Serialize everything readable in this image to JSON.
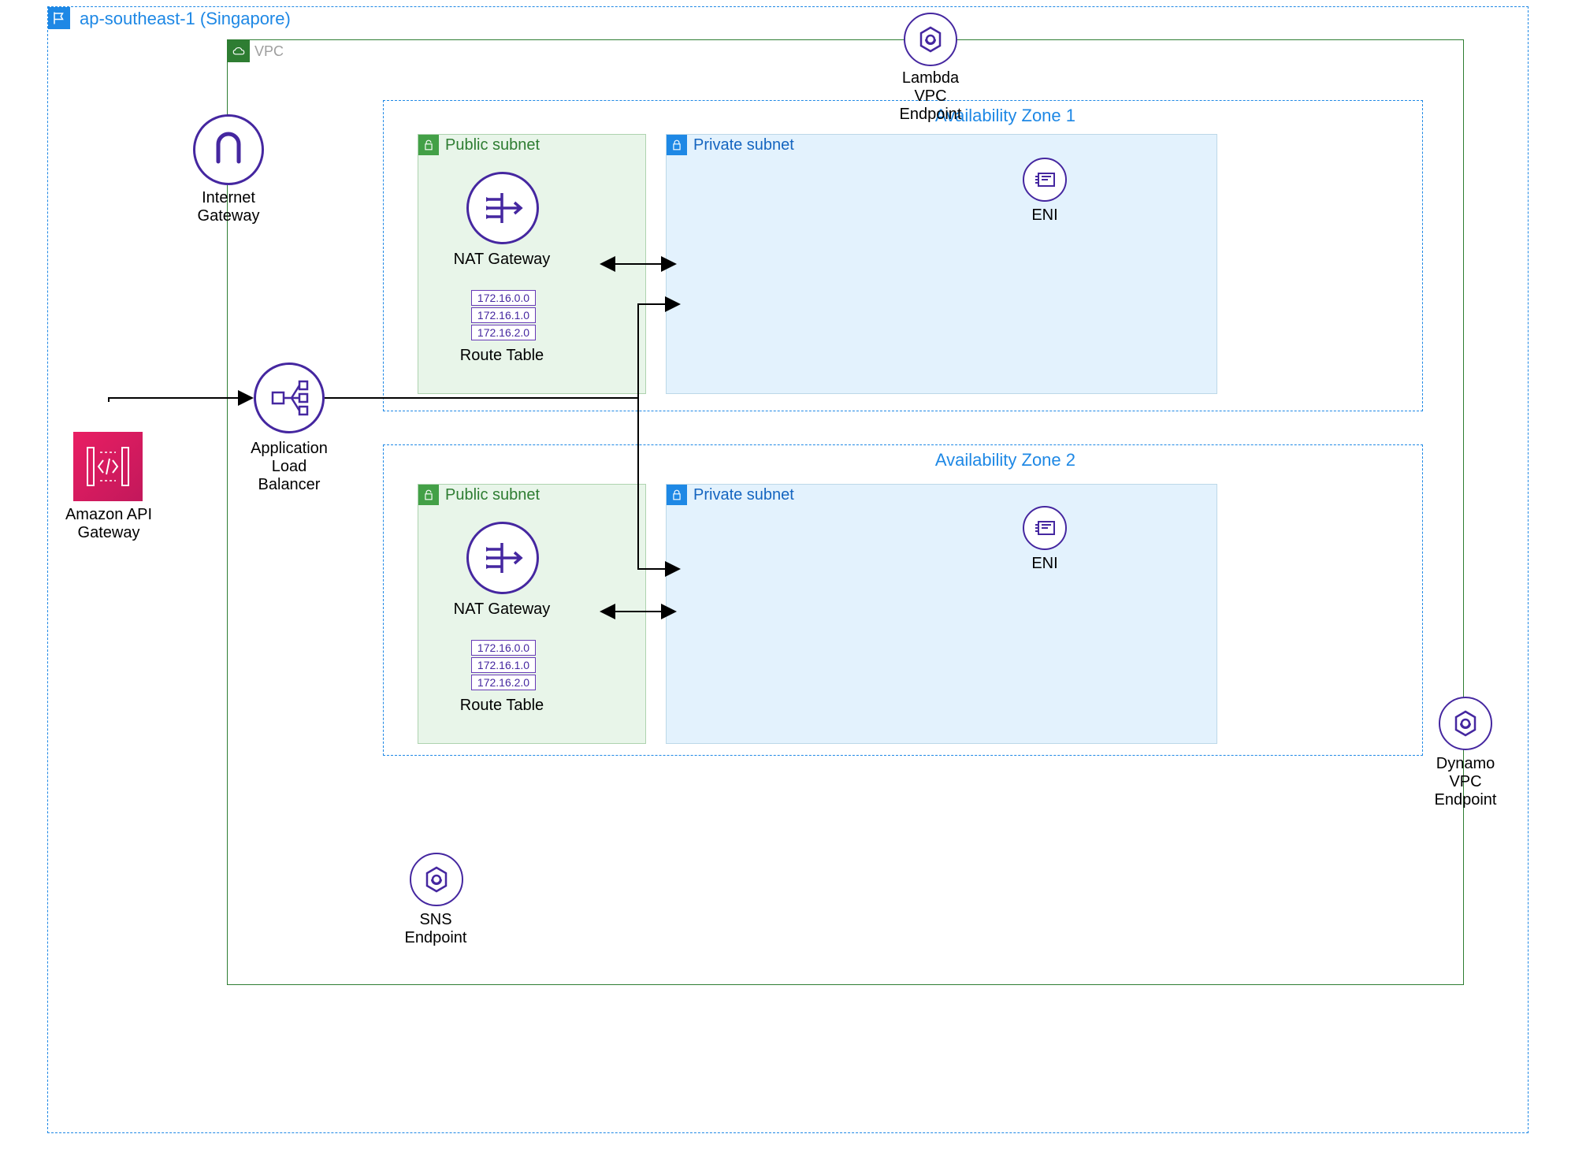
{
  "region": {
    "label": "ap-southeast-1 (Singapore)"
  },
  "vpc": {
    "label": "VPC"
  },
  "availability_zones": [
    {
      "label": "Availability Zone 1"
    },
    {
      "label": "Availability Zone 2"
    }
  ],
  "subnets": {
    "public_label": "Public subnet",
    "private_label": "Private subnet"
  },
  "components": {
    "internet_gateway": "Internet\nGateway",
    "api_gateway": "Amazon API\nGateway",
    "alb": "Application\nLoad\nBalancer",
    "nat_gateway": "NAT Gateway",
    "route_table": "Route Table",
    "eni": "ENI",
    "lambda_endpoint": "Lambda\nVPC\nEndpoint",
    "dynamo_endpoint": "Dynamo\nVPC\nEndpoint",
    "sns_endpoint": "SNS\nEndpoint"
  },
  "route_entries": [
    "172.16.0.0",
    "172.16.1.0",
    "172.16.2.0"
  ],
  "colors": {
    "region_border": "#1E88E5",
    "vpc_border": "#2E7D32",
    "purple": "#4527A0",
    "pink": "#D81B60"
  }
}
